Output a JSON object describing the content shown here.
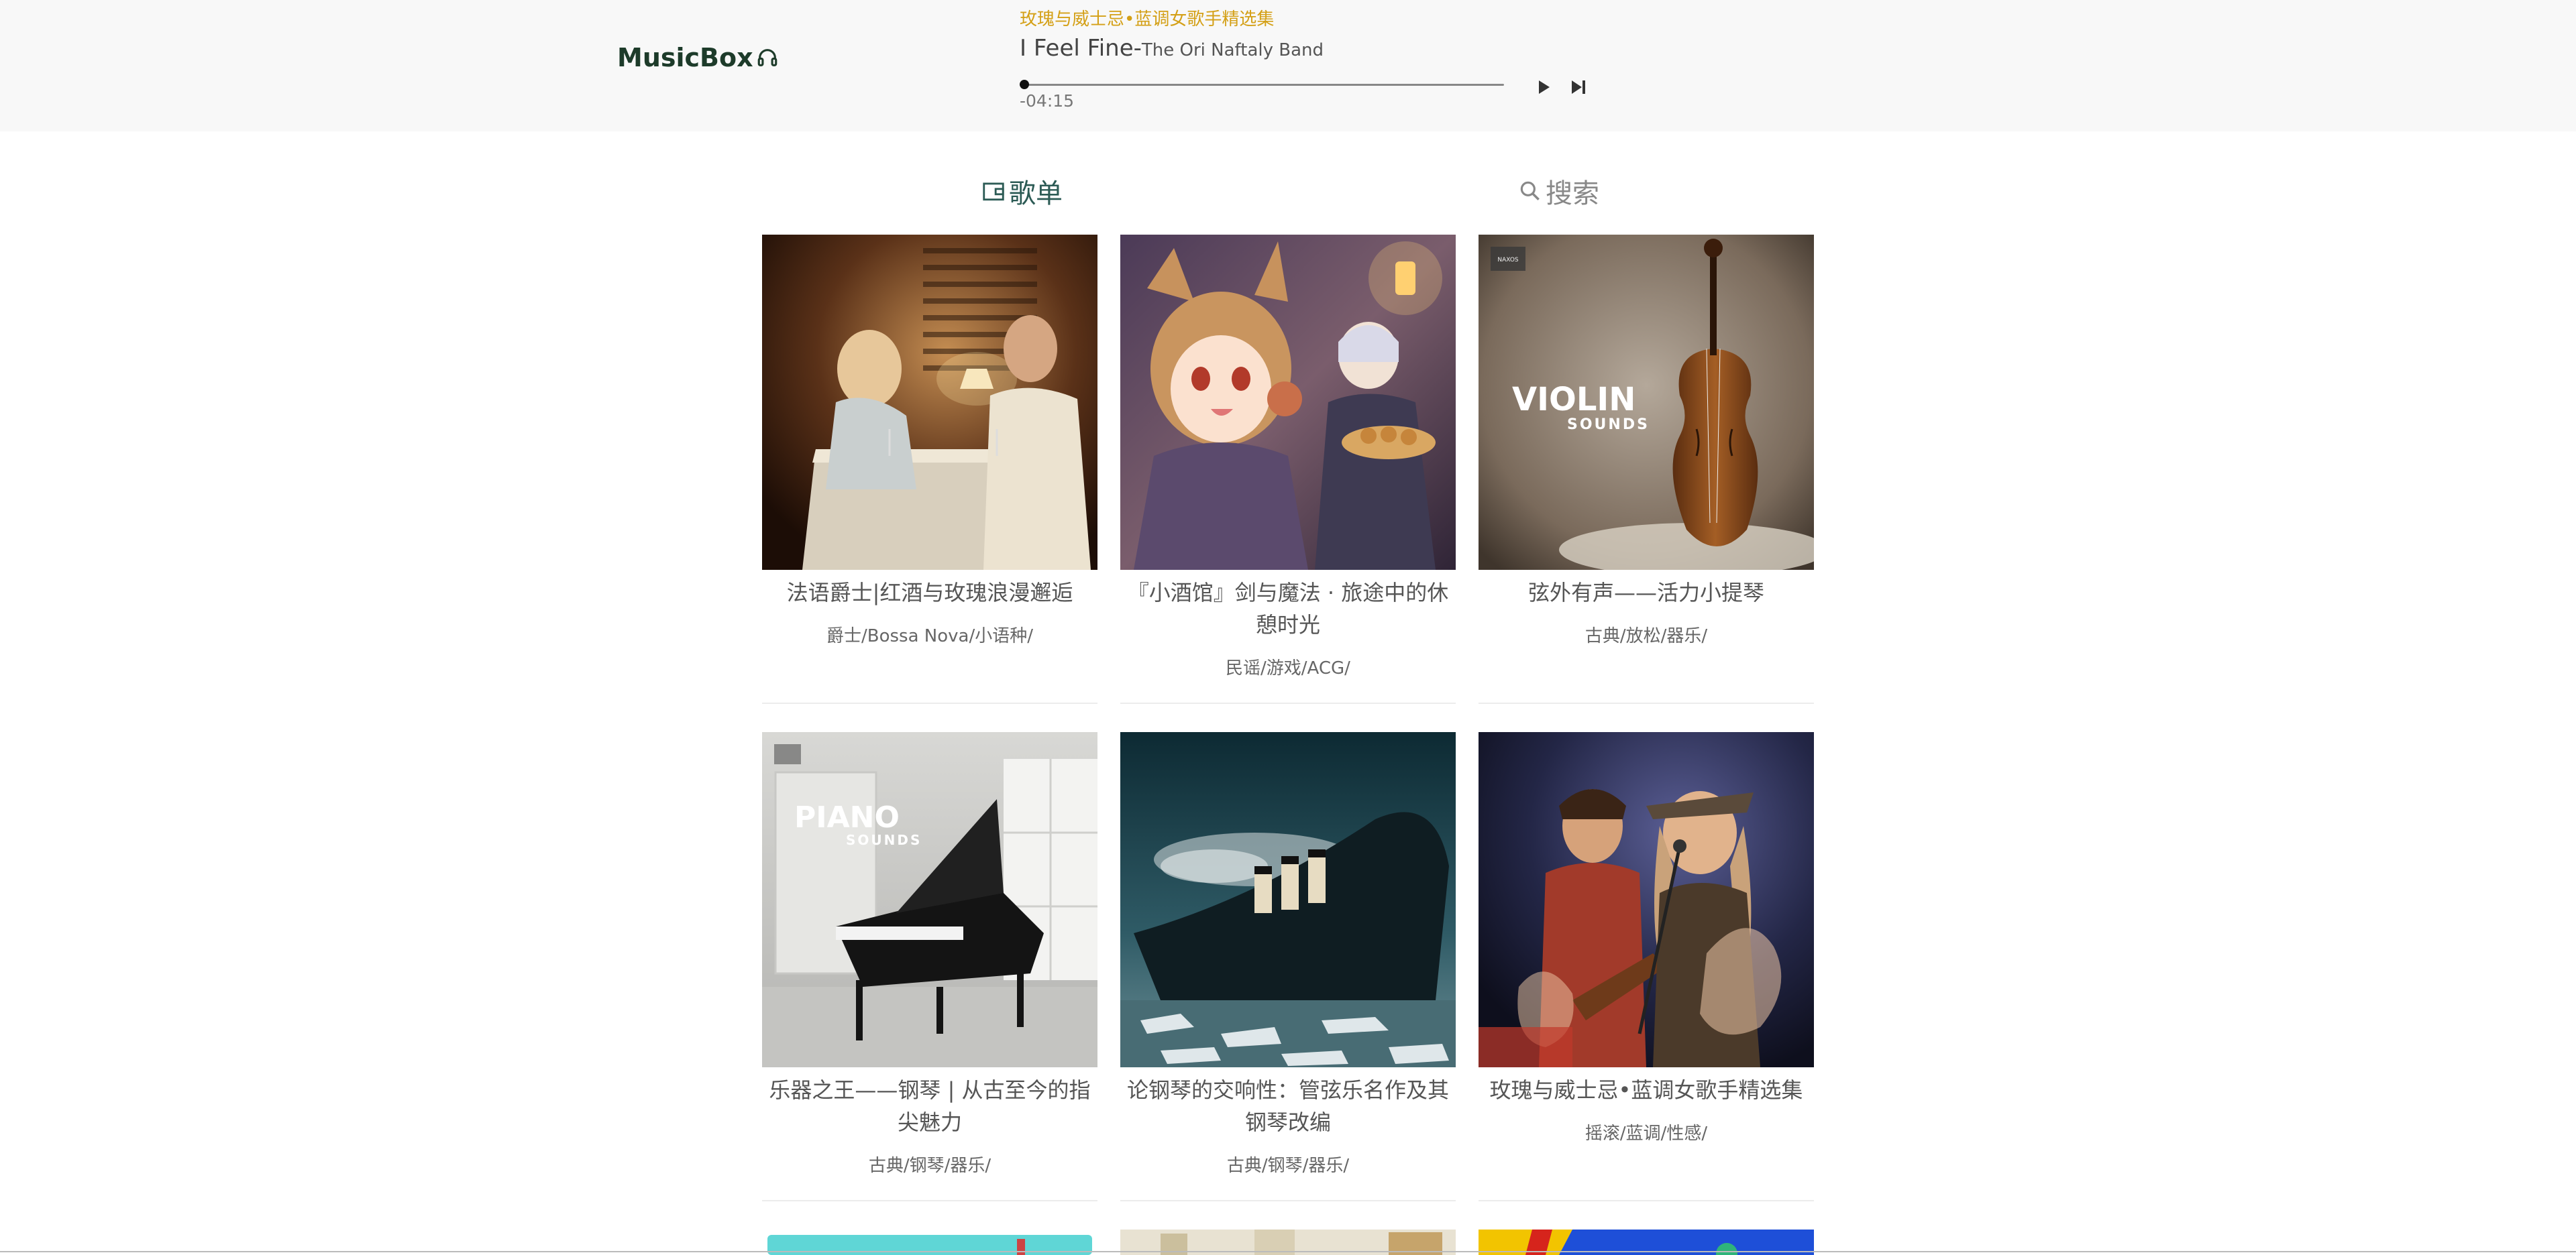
{
  "app": {
    "logo_text": "MusicBox",
    "brand_color": "#1d3b2a",
    "accent_color": "#d4a017"
  },
  "player": {
    "playlist_name": "玫瑰与威士忌•蓝调女歌手精选集",
    "song_title": "I Feel Fine",
    "separator": "-",
    "artist": "The Ori Naftaly Band",
    "time_remaining": "-04:15",
    "progress": 0.0,
    "play_icon": "play-icon",
    "next_icon": "skip-next-icon"
  },
  "tabs": [
    {
      "label": "歌单",
      "icon": "playlist-icon",
      "active": true
    },
    {
      "label": "搜索",
      "icon": "search-icon",
      "active": false
    }
  ],
  "playlists": [
    {
      "title": "法语爵士|红酒与玫瑰浪漫邂逅",
      "tags": "爵士/Bossa Nova/小语种/"
    },
    {
      "title": "『小酒馆』剑与魔法 · 旅途中的休憩时光",
      "tags": "民谣/游戏/ACG/"
    },
    {
      "title": "弦外有声——活力小提琴",
      "tags": "古典/放松/器乐/"
    },
    {
      "title": "乐器之王——钢琴 | 从古至今的指尖魅力",
      "tags": "古典/钢琴/器乐/"
    },
    {
      "title": "论钢琴的交响性：管弦乐名作及其钢琴改编",
      "tags": "古典/钢琴/器乐/"
    },
    {
      "title": "玫瑰与威士忌•蓝调女歌手精选集",
      "tags": "摇滚/蓝调/性感/"
    }
  ],
  "covers": {
    "violin_title": "VIOLIN",
    "violin_sub": "SOUNDS",
    "piano_title": "PIANO",
    "piano_sub": "SOUNDS",
    "label_badge": "NAXOS"
  }
}
